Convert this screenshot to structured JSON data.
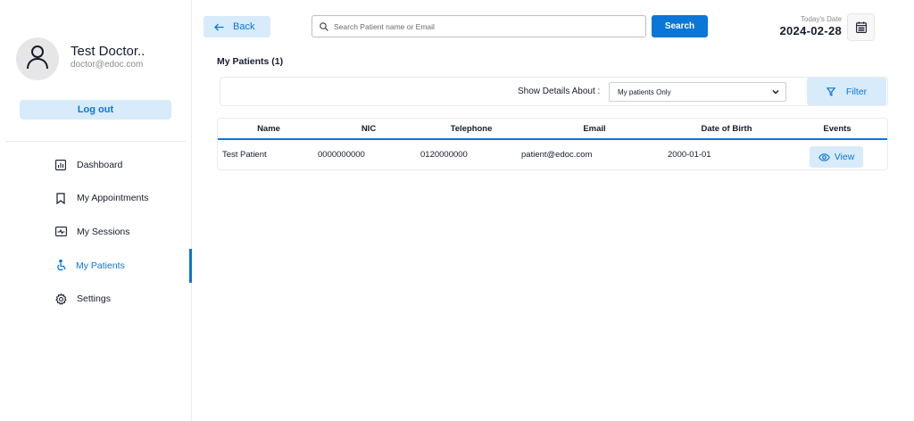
{
  "sidebar": {
    "profile": {
      "name": "Test Doctor..",
      "email": "doctor@edoc.com",
      "avatar_icon": "user-icon"
    },
    "logout_label": "Log out",
    "menu": [
      {
        "label": "Dashboard",
        "icon": "dashboard-icon",
        "active": false
      },
      {
        "label": "My Appointments",
        "icon": "bookmark-icon",
        "active": false
      },
      {
        "label": "My Sessions",
        "icon": "sessions-icon",
        "active": false
      },
      {
        "label": "My Patients",
        "icon": "wheelchair-icon",
        "active": true
      },
      {
        "label": "Settings",
        "icon": "gear-icon",
        "active": false
      }
    ]
  },
  "topbar": {
    "back_label": "Back",
    "search_placeholder": "Search Patient name or Email",
    "search_button": "Search",
    "date_label": "Today's Date",
    "date_value": "2024-02-28"
  },
  "main": {
    "title": "My Patients (1)",
    "filter": {
      "label": "Show Details About :",
      "selected": "My patients Only",
      "button": "Filter"
    },
    "table": {
      "columns": [
        "Name",
        "NIC",
        "Telephone",
        "Email",
        "Date of Birth",
        "Events"
      ],
      "rows": [
        {
          "name": "Test Patient",
          "nic": "0000000000",
          "telephone": "0120000000",
          "email": "patient@edoc.com",
          "dob": "2000-01-01",
          "action": "View"
        }
      ]
    }
  },
  "colors": {
    "accent": "#0a76d8",
    "accent_light": "#d8ebfa",
    "text": "#161c2d"
  }
}
